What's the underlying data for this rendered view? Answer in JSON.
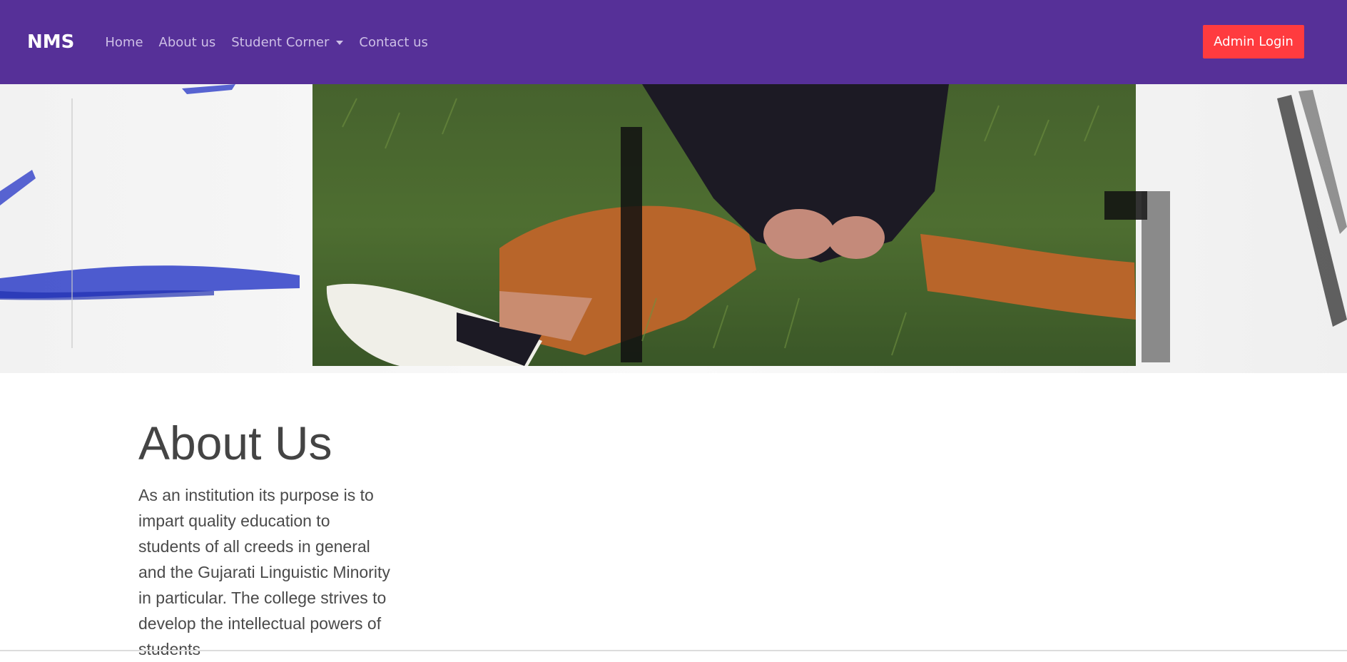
{
  "navbar": {
    "brand": "NMS",
    "links": [
      {
        "label": "Home"
      },
      {
        "label": "About us"
      },
      {
        "label": "Student Corner"
      },
      {
        "label": "Contact us"
      }
    ],
    "login_label": "Admin Login"
  },
  "colors": {
    "navbar_bg": "#563098",
    "login_btn": "#ff3b3f"
  },
  "about": {
    "title": "About Us",
    "text": "As an institution its purpose is to impart quality education to students of all creeds in general and the Gujarati Linguistic Minority in particular. The college strives to develop the intellectual powers of students"
  }
}
